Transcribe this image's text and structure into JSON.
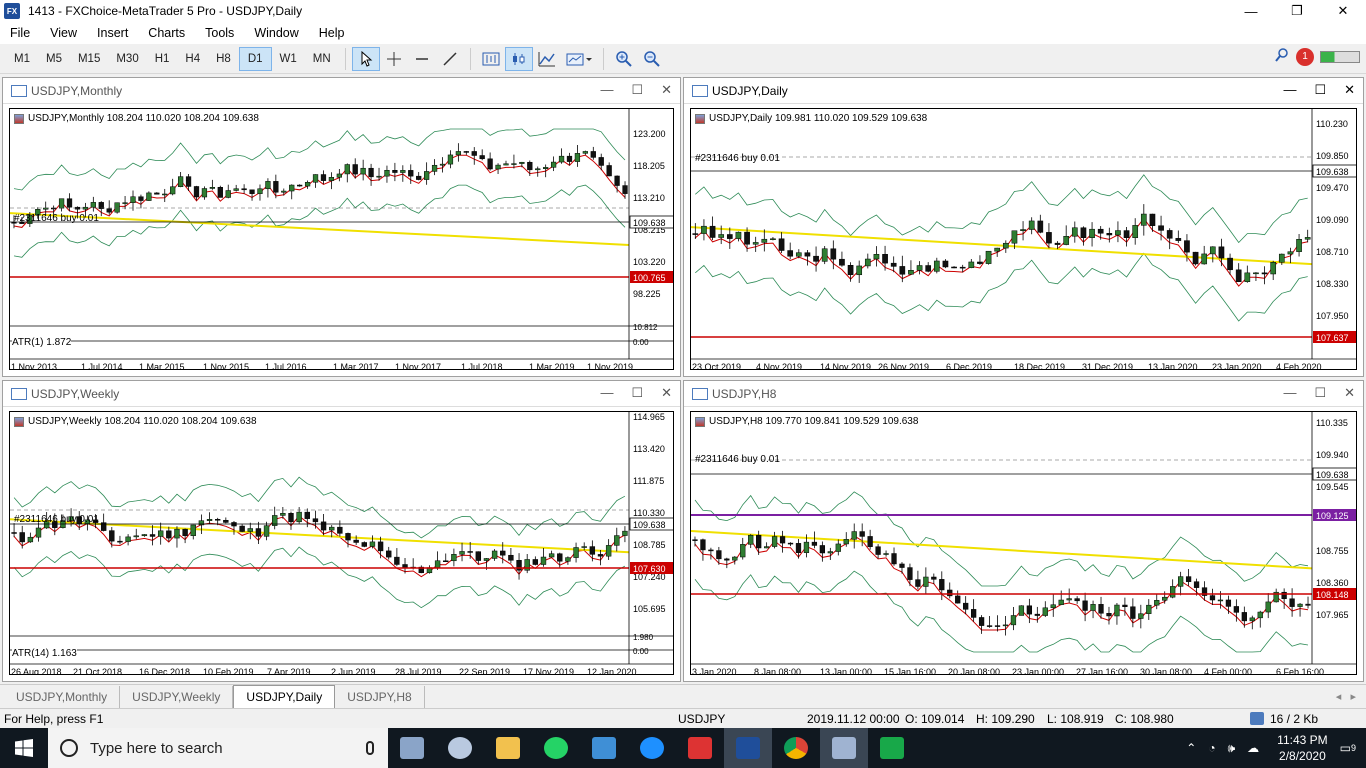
{
  "app": {
    "title": "1413 - FXChoice-MetaTrader 5 Pro - USDJPY,Daily",
    "icon_text": "FX",
    "window_controls": [
      "—",
      "❐",
      "✕"
    ]
  },
  "menu": [
    "File",
    "View",
    "Insert",
    "Charts",
    "Tools",
    "Window",
    "Help"
  ],
  "toolbar": {
    "timeframes": [
      "M1",
      "M5",
      "M15",
      "M30",
      "H1",
      "H4",
      "H8",
      "D1",
      "W1",
      "MN"
    ],
    "selected_timeframe": "D1",
    "notifications_count": "1"
  },
  "charts": {
    "monthly": {
      "window_title": "USDJPY,Monthly",
      "header": "USDJPY,Monthly  108.204 110.020 108.204 109.638",
      "order_label": "#2311646 buy 0.01",
      "indicator_label": "ATR(1) 1.872",
      "y_ticks": [
        "123.200",
        "118.205",
        "113.210",
        "108.215",
        "103.220",
        "98.225"
      ],
      "price_tag": "109.638",
      "line_tag": "100.765",
      "ind_ticks": [
        "10.812",
        "0.00"
      ],
      "x_ticks": [
        "1 Nov 2013",
        "1 Jul 2014",
        "1 Mar 2015",
        "1 Nov 2015",
        "1 Jul 2016",
        "1 Mar 2017",
        "1 Nov 2017",
        "1 Jul 2018",
        "1 Mar 2019",
        "1 Nov 2019"
      ]
    },
    "daily": {
      "window_title": "USDJPY,Daily",
      "header": "USDJPY,Daily  109.981 110.020 109.529 109.638",
      "order_label": "#2311646 buy 0.01",
      "y_ticks": [
        "110.230",
        "109.850",
        "109.470",
        "109.090",
        "108.710",
        "108.330",
        "107.950"
      ],
      "price_tag": "109.638",
      "line_tag": "107.637",
      "x_ticks": [
        "23 Oct 2019",
        "4 Nov 2019",
        "14 Nov 2019",
        "26 Nov 2019",
        "6 Dec 2019",
        "18 Dec 2019",
        "31 Dec 2019",
        "13 Jan 2020",
        "23 Jan 2020",
        "4 Feb 2020"
      ]
    },
    "weekly": {
      "window_title": "USDJPY,Weekly",
      "header": "USDJPY,Weekly  108.204 110.020 108.204 109.638",
      "order_label": "#2311646 buy 0.01",
      "indicator_label": "ATR(14) 1.163",
      "y_ticks": [
        "114.965",
        "113.420",
        "111.875",
        "110.330",
        "108.785",
        "107.240",
        "105.695"
      ],
      "price_tag": "109.638",
      "line_tag": "107.630",
      "ind_ticks": [
        "1.980",
        "0.00"
      ],
      "x_ticks": [
        "26 Aug 2018",
        "21 Oct 2018",
        "16 Dec 2018",
        "10 Feb 2019",
        "7 Apr 2019",
        "2 Jun 2019",
        "28 Jul 2019",
        "22 Sep 2019",
        "17 Nov 2019",
        "12 Jan 2020"
      ]
    },
    "h8": {
      "window_title": "USDJPY,H8",
      "header": "USDJPY,H8  109.770 109.841 109.529 109.638",
      "order_label": "#2311646 buy 0.01",
      "y_ticks": [
        "110.335",
        "109.940",
        "109.545",
        "108.755",
        "108.360",
        "107.965"
      ],
      "price_tag": "109.638",
      "mid_tag": "109.125",
      "line_tag": "108.148",
      "x_ticks": [
        "3 Jan 2020",
        "8 Jan 08:00",
        "13 Jan 00:00",
        "15 Jan 16:00",
        "20 Jan 08:00",
        "23 Jan 00:00",
        "27 Jan 16:00",
        "30 Jan 08:00",
        "4 Feb 00:00",
        "6 Feb 16:00"
      ]
    }
  },
  "tabs": [
    "USDJPY,Monthly",
    "USDJPY,Weekly",
    "USDJPY,Daily",
    "USDJPY,H8"
  ],
  "active_tab": "USDJPY,Daily",
  "status": {
    "help": "For Help, press F1",
    "symbol": "USDJPY",
    "datetime": "2019.11.12 00:00",
    "open": "O: 109.014",
    "high": "H: 109.290",
    "low": "L: 108.919",
    "close": "C: 108.980",
    "traffic": "16 / 2 Kb"
  },
  "taskbar": {
    "search_placeholder": "Type here to search",
    "time": "11:43 PM",
    "date": "2/8/2020",
    "notifications": "9"
  },
  "colors": {
    "bull": "#2f7d32",
    "bear": "#111111",
    "ma_red": "#cc0000",
    "ma_yellow": "#f0e000",
    "bands": "#2e8b57",
    "level_red": "#cc0000",
    "purple": "#7b1fa2"
  }
}
